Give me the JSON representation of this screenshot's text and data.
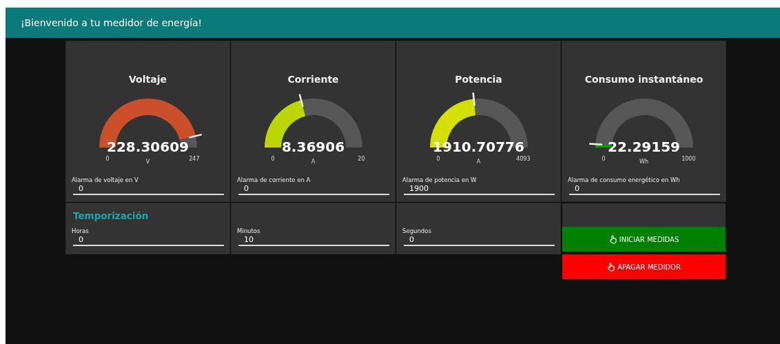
{
  "header": {
    "title": "¡Bienvenido a tu medidor de energía!"
  },
  "gauges": [
    {
      "title": "Voltaje",
      "value": "228.30609",
      "unit": "V",
      "min": "0",
      "max": "247",
      "color": "#cb4f2a",
      "alarm_label": "Alarma de voltaje en V",
      "alarm_value": "0"
    },
    {
      "title": "Corriente",
      "value": "8.36906",
      "unit": "A",
      "min": "0",
      "max": "20",
      "color": "#bcd600",
      "alarm_label": "Alarma de corriente en A",
      "alarm_value": "0"
    },
    {
      "title": "Potencia",
      "value": "1910.70776",
      "unit": "A",
      "min": "0",
      "max": "4093",
      "color": "#d4e000",
      "alarm_label": "Alarma de potencia en W",
      "alarm_value": "1900"
    },
    {
      "title": "Consumo instantáneo",
      "value": "22.29159",
      "unit": "Wh",
      "min": "0",
      "max": "1000",
      "color": "#00a000",
      "alarm_label": "Alarma de consumo energético en Wh",
      "alarm_value": "0"
    }
  ],
  "timer": {
    "title": "Temporización",
    "fields": [
      {
        "label": "Horas",
        "value": "0"
      },
      {
        "label": "Minutos",
        "value": "10"
      },
      {
        "label": "Segundos",
        "value": "0"
      }
    ]
  },
  "buttons": [
    {
      "label": "INICIAR MEDIDAS",
      "kind": "start"
    },
    {
      "label": "APAGAR MEDIDOR",
      "kind": "stop"
    }
  ]
}
